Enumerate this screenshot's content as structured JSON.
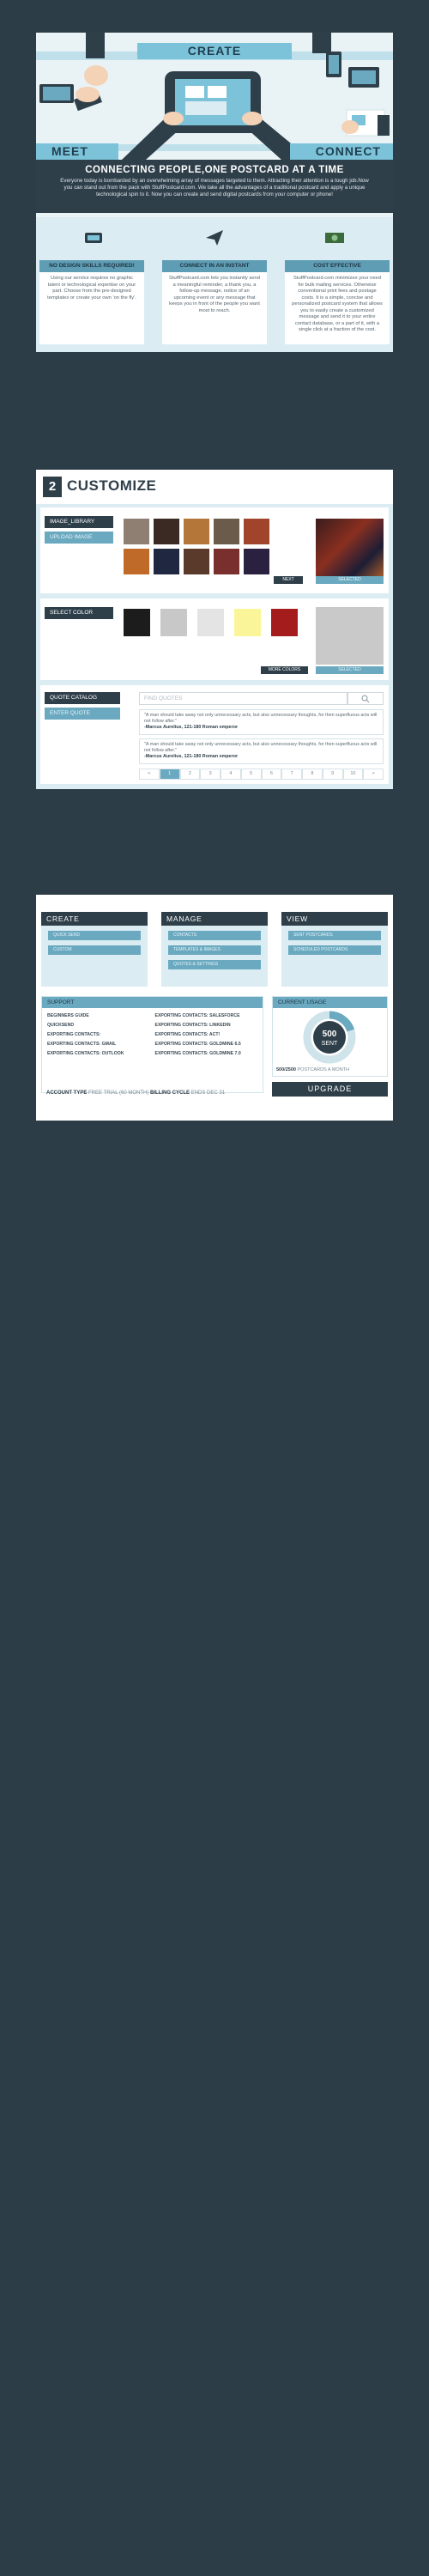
{
  "panel1": {
    "banner_create": "CREATE",
    "banner_meet": "MEET",
    "banner_connect": "CONNECT",
    "headline": "CONNECTING PEOPLE,ONE POSTCARD AT A TIME",
    "intro": "Everyone today is bombarded by an overwhelming array of messages targeted to them. Attracting their attention is a tough job.Now you can stand out from the pack with StuffPostcard.com. We take all the advantages of a traditional postcard and apply a unique technological spin to it. Now you can create and send digital postcards from your computer or phone!",
    "features": [
      {
        "title": "NO DESIGN SKILLS REQUIRED!",
        "desc": "Using our service requires no graphic talent or technological expertise on your part. Choose from the pre-designed templates or create your own 'on the fly'."
      },
      {
        "title": "CONNECT IN AN INSTANT",
        "desc": "StuffPostcard.com lets you instantly send a meaningful reminder, a thank you, a follow-up message, notice of an upcoming event or any message that keeps you in front of the people you want most to reach."
      },
      {
        "title": "COST EFFECTIVE",
        "desc": "StuffPostcard.com minimizes your need for bulk mailing services. Otherwise conventional print fees and postage costs. It is a simple, concise and personalized postcard system that allows you to easily create a customized message and send it to your entire contact database, or a part of it, with a single click at a fraction of the cost."
      }
    ]
  },
  "panel2": {
    "step": "2",
    "title": "CUSTOMIZE",
    "image_library_label": "IMAGE_LIBRARY",
    "upload_image_label": "UPLOAD IMAGE",
    "next_label": "NEXT",
    "selected_label": "SELECTED",
    "select_color_label": "SELECT COLOR",
    "more_colors_label": "MORE COLORS",
    "quote_catalog_label": "QUOTE CATALOG",
    "enter_quote_label": "ENTER QUOTE",
    "find_quotes_placeholder": "FIND QUOTES",
    "quotes": [
      {
        "text": "\"A man should take away not only unnecessary acts, but also unnecessary thoughts, for then superfluous acts will not follow after.\"",
        "author": "-Marcus Aurelius, 121-180 Roman emperor"
      },
      {
        "text": "\"A man should take away not only unnecessary acts, but also unnecessary thoughts, for then superfluous acts will not follow after.\"",
        "author": "-Marcus Aurelius, 121-180 Roman emperor"
      }
    ],
    "pager": [
      "<",
      "1",
      "2",
      "3",
      "4",
      "5",
      "6",
      "7",
      "8",
      "9",
      "10",
      ">"
    ],
    "colors": [
      "#1c1c1c",
      "#c8c8c8",
      "#e4e4e4",
      "#fbf59a",
      "#a51c1c"
    ],
    "selected_color": "#c9c9c9"
  },
  "panel3": {
    "create": {
      "title": "CREATE",
      "buttons": [
        "QUICK SEND",
        "CUSTOM"
      ]
    },
    "manage": {
      "title": "MANAGE",
      "buttons": [
        "CONTACTS",
        "TEMPLATES & IMAGES",
        "QUOTES & SETTINGS"
      ]
    },
    "view": {
      "title": "VIEW",
      "buttons": [
        "SENT POSTCARDS",
        "SCHEDULED POSTCARDS"
      ]
    },
    "support": {
      "title": "SUPPORT",
      "links": [
        "BEGINNERS GUIDE",
        "EXPORTING CONTACTS: SALESFORCE",
        "QUICKSEND",
        "EXPORTING CONTACTS: LINKEDIN",
        "EXPORTING CONTACTS:",
        "EXPORTING CONTACTS: ACT!",
        "EXPORTING CONTACTS: GMAIL",
        "EXPORTING CONTACTS: GOLDMINE 6.5",
        "EXPORTING CONTACTS: OUTLOOK",
        "EXPORTING CONTACTS: GOLDMINE 7.0"
      ]
    },
    "account_type_label": "ACCOUNT TYPE",
    "account_type_value": "FREE TRIAL (60 MONTH)",
    "billing_cycle_label": "BILLING CYCLE",
    "billing_cycle_value": "ENDS DEC 31",
    "usage": {
      "title": "CURRENT USAGE",
      "sent_number": "500",
      "sent_label": "SENT",
      "ratio": "500/2500",
      "ratio_label": "POSTCARDS A MONTH",
      "used_fraction": 0.2
    },
    "upgrade_label": "UPGRADE"
  },
  "colors": {
    "dark": "#2f3f4a",
    "accent": "#6aa9c0",
    "light": "#dbecf2",
    "background": "#2c3d47"
  }
}
